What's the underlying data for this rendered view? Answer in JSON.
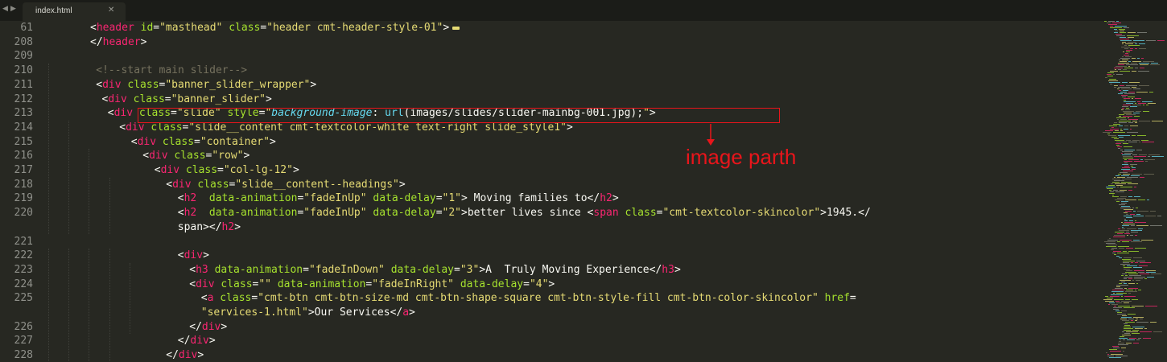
{
  "tabbar": {
    "back_arrow": "◀",
    "forward_arrow": "▶",
    "active_tab": {
      "label": "index.html",
      "close": "✕"
    }
  },
  "editor": {
    "line_numbers": [
      "61",
      "208",
      "209",
      "210",
      "211",
      "212",
      "213",
      "214",
      "215",
      "216",
      "217",
      "218",
      "219",
      "220",
      "",
      "221",
      "222",
      "223",
      "224",
      "225",
      "",
      "226",
      "227",
      "228"
    ],
    "lines": [
      "<header id=\"masthead\" class=\"header cmt-header-style-01\">",
      "</header>",
      "",
      "<!--start main slider-->",
      "<div class=\"banner_slider_wrapper\">",
      "<div class=\"banner_slider\">",
      "<div class=\"slide\" style=\"background-image: url(images/slides/slider-mainbg-001.jpg);\">",
      "<div class=\"slide__content cmt-textcolor-white text-right slide_style1\">",
      "<div class=\"container\">",
      "<div class=\"row\">",
      "<div class=\"col-lg-12\">",
      "<div class=\"slide__content--headings\">",
      "<h2  data-animation=\"fadeInUp\" data-delay=\"1\"> Moving families to</h2>",
      "<h2  data-animation=\"fadeInUp\" data-delay=\"2\">better lives since <span class=\"cmt-textcolor-skincolor\">1945.</",
      "span></h2>",
      "",
      "<div>",
      "<h3 data-animation=\"fadeInDown\" data-delay=\"3\">A  Truly Moving Experience</h3>",
      "<div class=\"\" data-animation=\"fadeInRight\" data-delay=\"4\">",
      "<a class=\"cmt-btn cmt-btn-size-md cmt-btn-shape-square cmt-btn-style-fill cmt-btn-color-skincolor\" href=",
      "\"services-1.html\">Our Services</a>",
      "</div>",
      "</div>",
      "</div>"
    ]
  },
  "annotation": {
    "text": "image parth",
    "color": "#e8151b"
  },
  "colors": {
    "background": "#272822",
    "tag": "#f92672",
    "attribute": "#a6e22e",
    "string": "#e6db74",
    "comment": "#75715e",
    "css_property": "#66d9ef"
  }
}
